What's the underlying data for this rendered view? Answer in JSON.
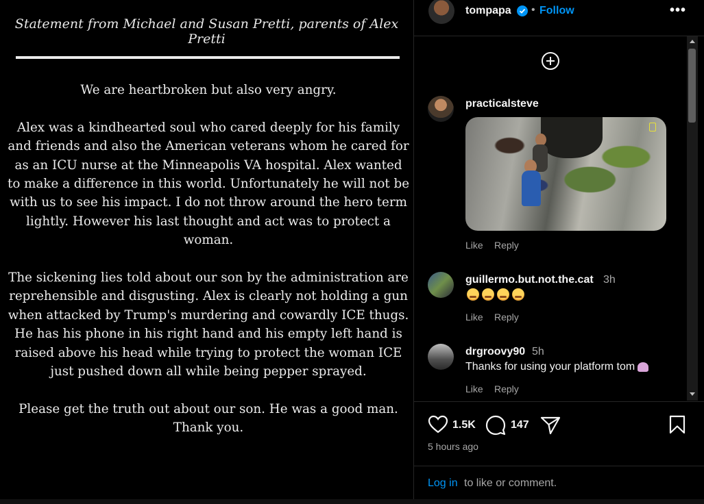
{
  "image_post": {
    "title": "Statement from Michael and Susan Pretti, parents of Alex Pretti",
    "paragraphs": [
      "We are heartbroken but also very angry.",
      "Alex was a kindhearted soul who cared deeply for his family and friends and also the American veterans whom he cared for as an ICU nurse at the Minneapolis VA hospital. Alex wanted to make a difference in this world. Unfortunately he will not be with us to see his impact. I do not throw around the hero term lightly. However his last thought and act was to protect a woman.",
      "The sickening lies told about our son by the administration are reprehensible and disgusting. Alex is clearly not holding a gun when attacked by Trump's murdering and cowardly ICE thugs. He has his phone in his right hand and his empty left hand is raised above his head while trying to protect the woman ICE just pushed down all while being pepper sprayed.",
      "Please get the truth out about our son. He was a good man. Thank you."
    ]
  },
  "header": {
    "username": "tompapa",
    "separator": "•",
    "follow_label": "Follow",
    "more_label": "•••"
  },
  "comments": [
    {
      "username": "practicalsteve",
      "time": "",
      "text": "",
      "has_gif": true,
      "like_label": "Like",
      "reply_label": "Reply"
    },
    {
      "username": "guillermo.but.not.the.cat",
      "time": "3h",
      "text": "",
      "emoji_count": 4,
      "like_label": "Like",
      "reply_label": "Reply"
    },
    {
      "username": "drgroovy90",
      "time": "5h",
      "text": "Thanks for using your platform tom",
      "like_label": "Like",
      "reply_label": "Reply"
    }
  ],
  "actions": {
    "likes": "1.5K",
    "comments_count": "147",
    "timestamp": "5 hours ago"
  },
  "login": {
    "link": "Log in",
    "rest": "to like or comment."
  }
}
